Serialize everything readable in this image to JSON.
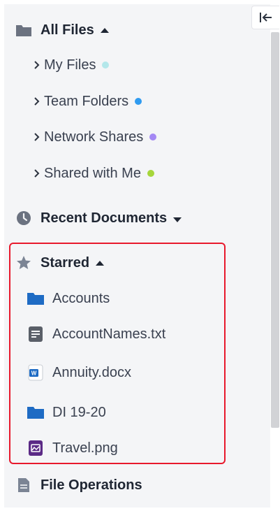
{
  "sidebar": {
    "collapse_icon": "collapse-left-icon",
    "all_files": {
      "label": "All Files",
      "icon": "folder-icon",
      "expanded": true,
      "children": [
        {
          "label": "My Files",
          "dot_color": "#b3e7ea"
        },
        {
          "label": "Team Folders",
          "dot_color": "#2f9bf0"
        },
        {
          "label": "Network Shares",
          "dot_color": "#a488f4"
        },
        {
          "label": "Shared with Me",
          "dot_color": "#a6d63b"
        }
      ]
    },
    "recent_documents": {
      "label": "Recent Documents",
      "icon": "clock-icon",
      "expanded": false
    },
    "starred": {
      "label": "Starred",
      "icon": "star-icon",
      "expanded": true,
      "items": [
        {
          "label": "Accounts",
          "icon": "folder-icon"
        },
        {
          "label": "AccountNames.txt",
          "icon": "text-file-icon"
        },
        {
          "label": "Annuity.docx",
          "icon": "word-file-icon"
        },
        {
          "label": "DI 19-20",
          "icon": "folder-icon"
        },
        {
          "label": "Travel.png",
          "icon": "image-file-icon"
        }
      ]
    },
    "file_operations": {
      "label": "File Operations",
      "icon": "document-icon"
    }
  },
  "colors": {
    "panel_bg": "#f4f5f7",
    "folder_gray": "#6b7280",
    "folder_blue": "#1e6bc4",
    "highlight": "#e8192c"
  }
}
